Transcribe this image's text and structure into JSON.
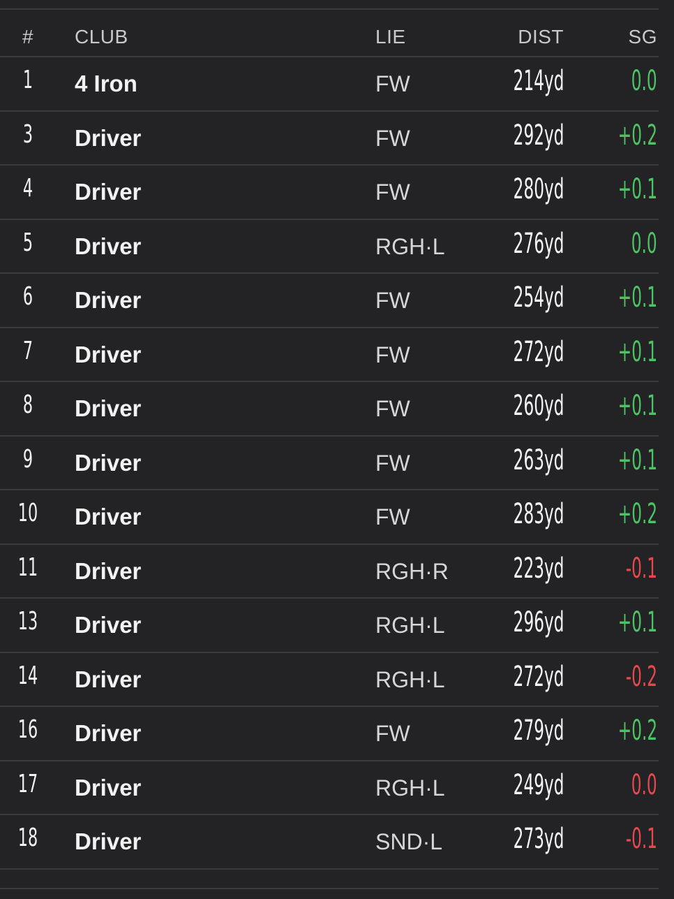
{
  "columns": {
    "num": "#",
    "club": "CLUB",
    "lie": "LIE",
    "dist": "DIST",
    "sg": "SG"
  },
  "colors": {
    "background": "#232325",
    "positive": "#4cc463",
    "negative": "#e5484d",
    "divider": "#3a3a3d"
  },
  "rows": [
    {
      "num": "1",
      "club": "4 Iron",
      "lie": "FW",
      "dist": "214yd",
      "sg": "0.0",
      "sg_tone": "positive"
    },
    {
      "num": "3",
      "club": "Driver",
      "lie": "FW",
      "dist": "292yd",
      "sg": "+0.2",
      "sg_tone": "positive"
    },
    {
      "num": "4",
      "club": "Driver",
      "lie": "FW",
      "dist": "280yd",
      "sg": "+0.1",
      "sg_tone": "positive"
    },
    {
      "num": "5",
      "club": "Driver",
      "lie": "RGH·L",
      "dist": "276yd",
      "sg": "0.0",
      "sg_tone": "positive"
    },
    {
      "num": "6",
      "club": "Driver",
      "lie": "FW",
      "dist": "254yd",
      "sg": "+0.1",
      "sg_tone": "positive"
    },
    {
      "num": "7",
      "club": "Driver",
      "lie": "FW",
      "dist": "272yd",
      "sg": "+0.1",
      "sg_tone": "positive"
    },
    {
      "num": "8",
      "club": "Driver",
      "lie": "FW",
      "dist": "260yd",
      "sg": "+0.1",
      "sg_tone": "positive"
    },
    {
      "num": "9",
      "club": "Driver",
      "lie": "FW",
      "dist": "263yd",
      "sg": "+0.1",
      "sg_tone": "positive"
    },
    {
      "num": "10",
      "club": "Driver",
      "lie": "FW",
      "dist": "283yd",
      "sg": "+0.2",
      "sg_tone": "positive"
    },
    {
      "num": "11",
      "club": "Driver",
      "lie": "RGH·R",
      "dist": "223yd",
      "sg": "-0.1",
      "sg_tone": "negative"
    },
    {
      "num": "13",
      "club": "Driver",
      "lie": "RGH·L",
      "dist": "296yd",
      "sg": "+0.1",
      "sg_tone": "positive"
    },
    {
      "num": "14",
      "club": "Driver",
      "lie": "RGH·L",
      "dist": "272yd",
      "sg": "-0.2",
      "sg_tone": "negative"
    },
    {
      "num": "16",
      "club": "Driver",
      "lie": "FW",
      "dist": "279yd",
      "sg": "+0.2",
      "sg_tone": "positive"
    },
    {
      "num": "17",
      "club": "Driver",
      "lie": "RGH·L",
      "dist": "249yd",
      "sg": "0.0",
      "sg_tone": "negative"
    },
    {
      "num": "18",
      "club": "Driver",
      "lie": "SND·L",
      "dist": "273yd",
      "sg": "-0.1",
      "sg_tone": "negative"
    }
  ]
}
